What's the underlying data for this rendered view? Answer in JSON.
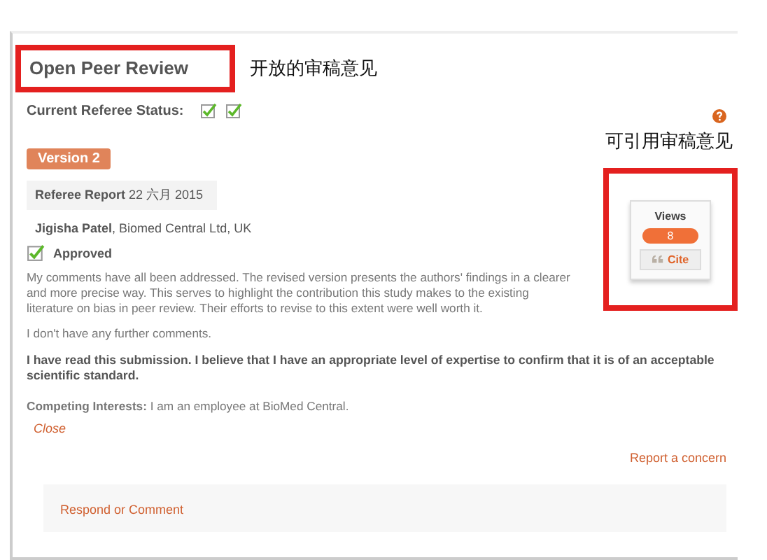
{
  "header": {
    "title": "Open Peer Review",
    "title_note": "开放的审稿意见",
    "status_label": "Current Referee Status:",
    "statuses": [
      {
        "checked": true
      },
      {
        "checked": true
      }
    ]
  },
  "side_note": "可引用审稿意见",
  "metrics": {
    "views_label": "Views",
    "views": "8",
    "cite": "Cite"
  },
  "version": "Version 2",
  "report": {
    "heading": "**Referee Report** 22 六月 2015",
    "reviewer": "**Jigisha Patel**, Biomed Central Ltd, UK",
    "verdict": {
      "checked": true,
      "label": "Approved"
    },
    "paragraphs": [
      "My comments have all been addressed. The revised version presents the authors' findings in a clearer and more precise way. This serves to highlight the contribution this study makes to the existing literature on bias in peer review. Their efforts to revise to this extent were well worth it.",
      "I don't have any further comments."
    ],
    "statement": "I have read this submission. I believe that I have an appropriate level of expertise to confirm that it is of an acceptable scientific standard.",
    "competing": "**Competing Interests:** I am an employee at BioMed Central.",
    "close": "Close"
  },
  "report_concern": "Report a concern",
  "respond": "Respond or Comment"
}
